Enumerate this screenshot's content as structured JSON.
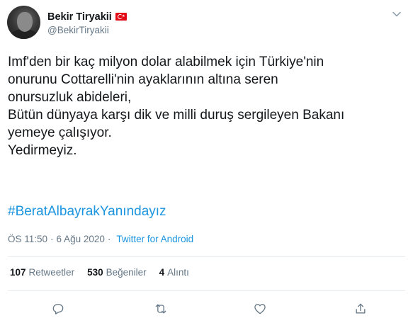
{
  "author": {
    "display_name": "Bekir Tiryakii",
    "handle": "@BekirTiryakii",
    "flag_icon": "turkey-flag-icon"
  },
  "tweet": {
    "text": "Imf'den bir kaç milyon dolar alabilmek için Türkiye'nin\nonurunu Cottarelli'nin ayaklarının altına seren\nonursuzluk abideleri,\nBütün dünyaya karşı dik ve milli duruş sergileyen Bakanı\nyemeye çalışıyor.\nYedirmeyiz.",
    "hashtag": "#BeratAlbayrakYanındayız"
  },
  "meta": {
    "time": "ÖS 11:50",
    "separator": "·",
    "date": "6 Ağu 2020",
    "source_separator": "·",
    "source": "Twitter for Android"
  },
  "stats": {
    "retweets_count": "107",
    "retweets_label": "Retweetler",
    "likes_count": "530",
    "likes_label": "Beğeniler",
    "quotes_count": "4",
    "quotes_label": "Alıntı"
  },
  "actions": [
    "reply-icon",
    "retweet-icon",
    "like-icon",
    "share-icon"
  ],
  "colors": {
    "link": "#1b95e0",
    "secondary_text": "#657786",
    "primary_text": "#14171a",
    "divider": "#e6ecf0",
    "flag_red": "#e30a17"
  }
}
